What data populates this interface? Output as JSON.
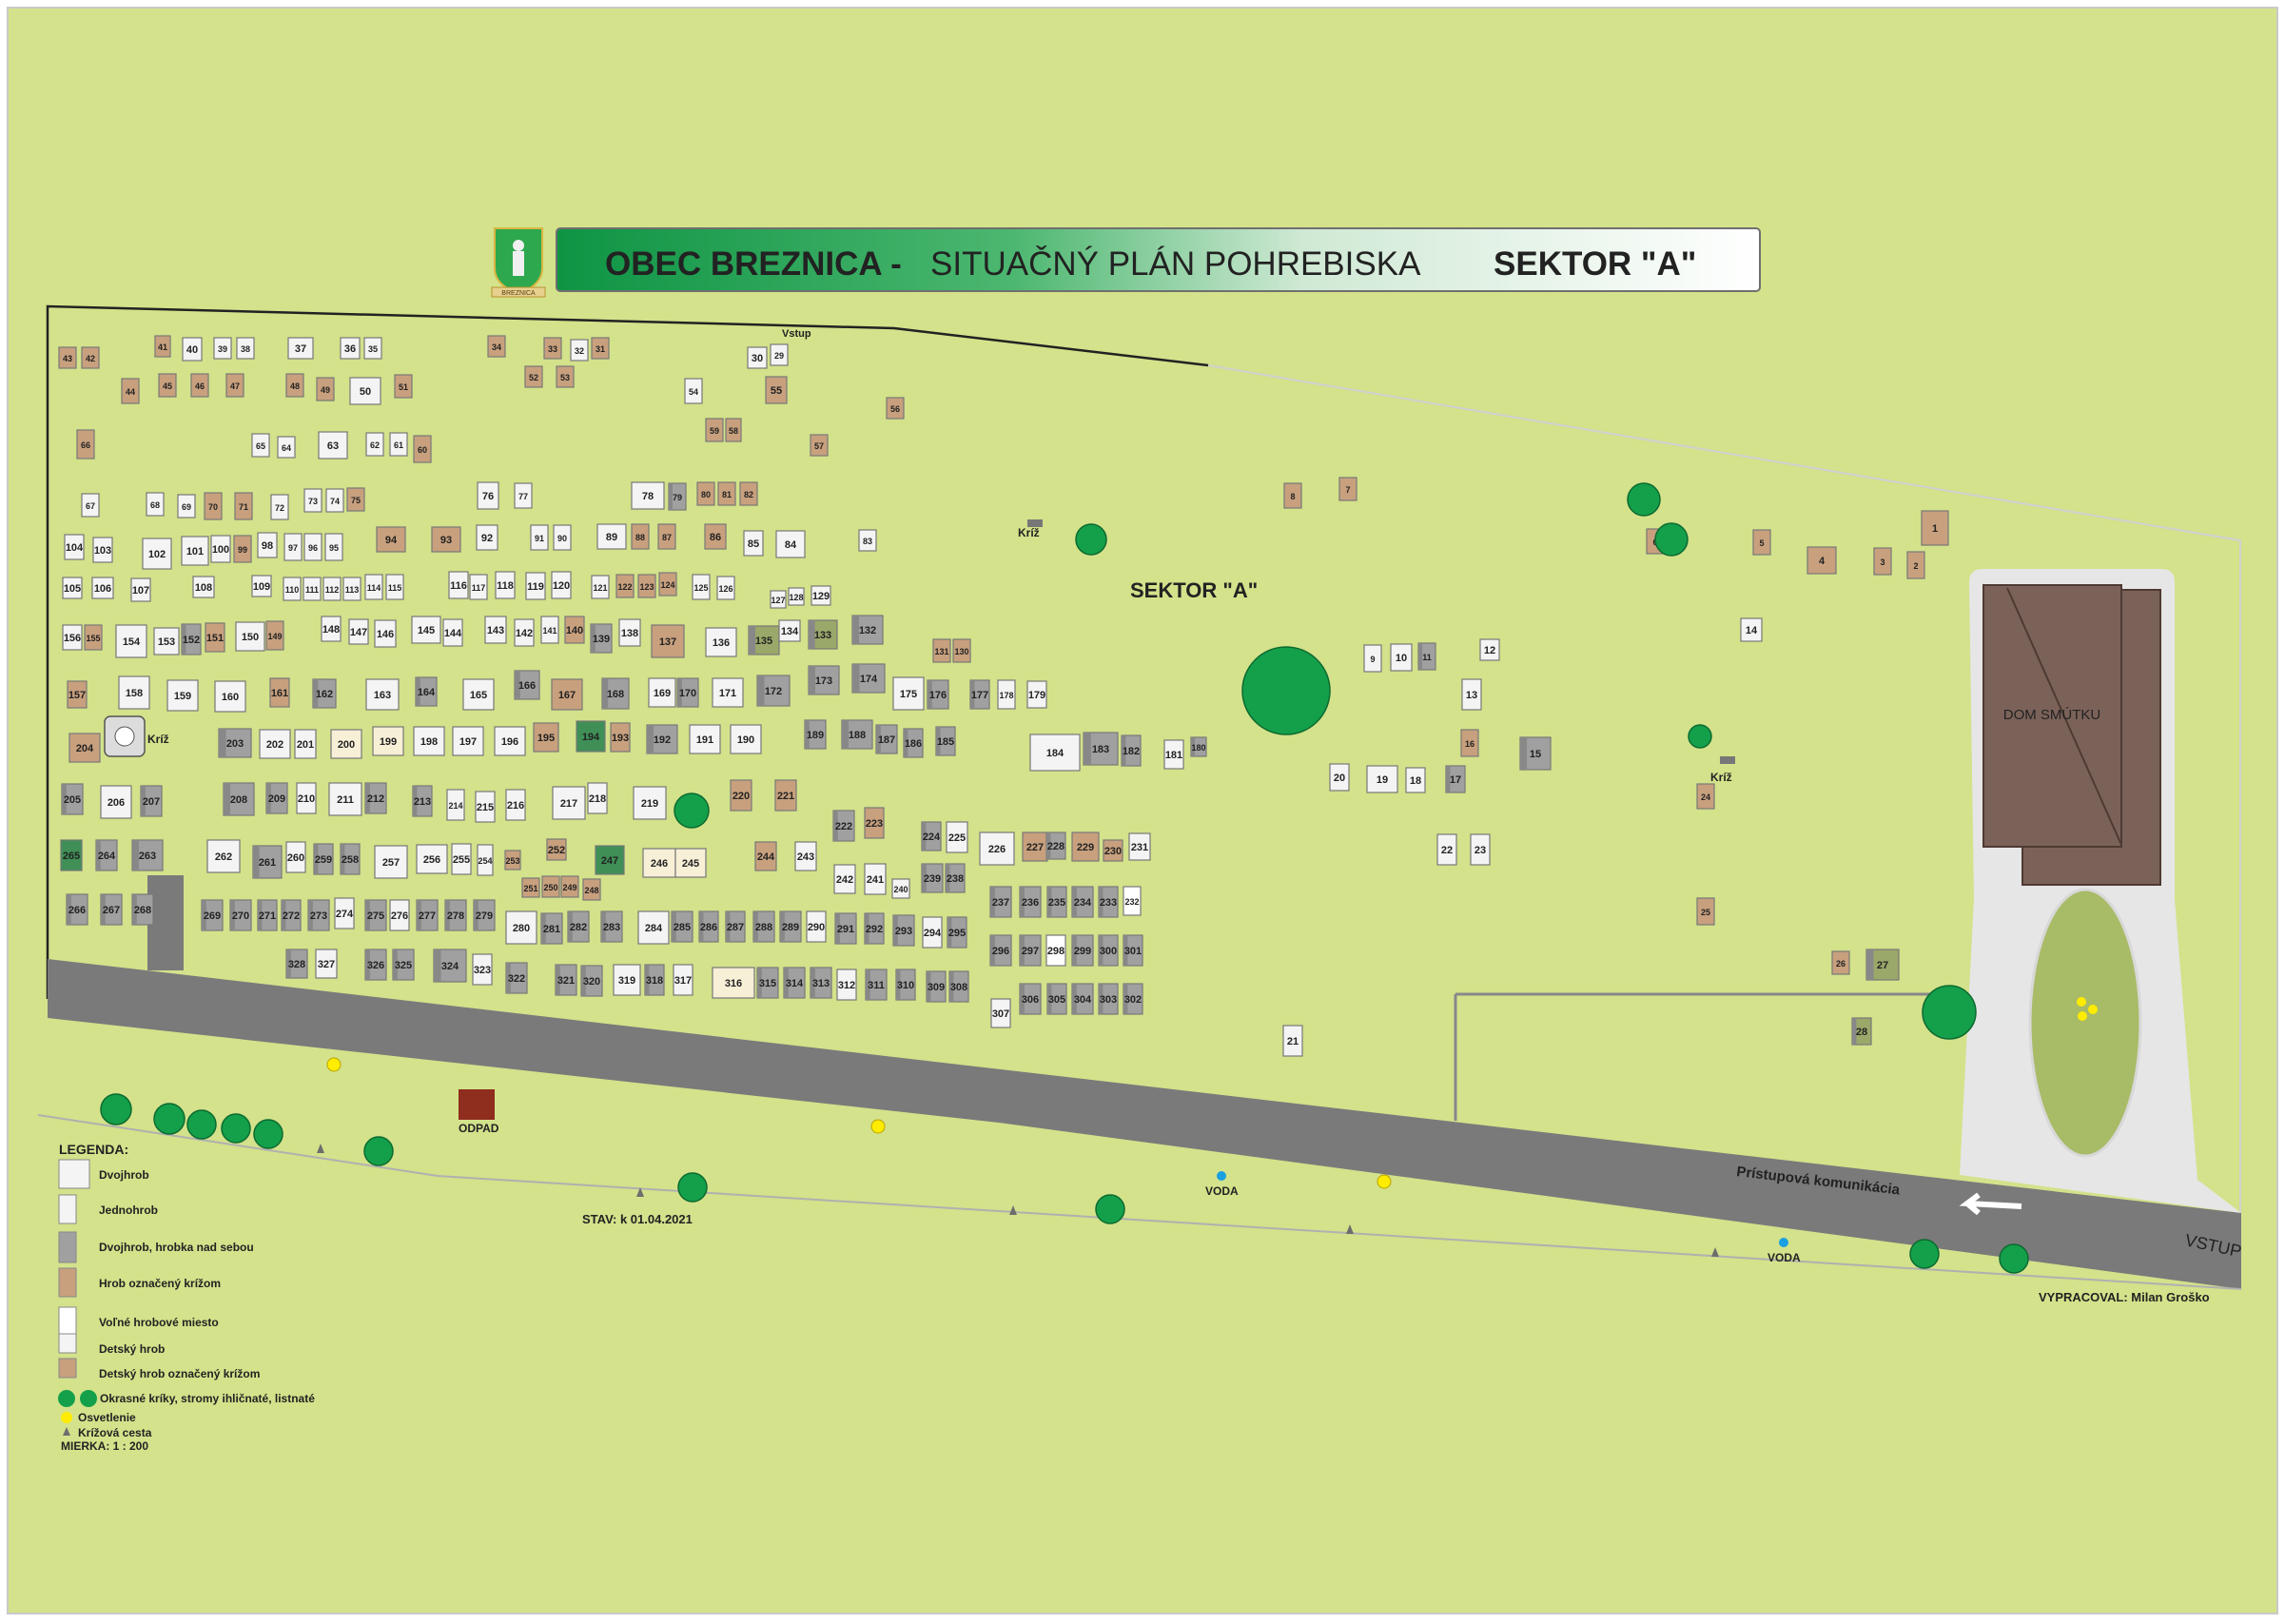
{
  "header": {
    "title_a": "OBEC  BREZNICA - ",
    "title_b": "SITUAČNÝ PLÁN POHREBISKA",
    "title_c": "SEKTOR  \"A\"",
    "crest_text": "BREZNICA"
  },
  "labels": {
    "sector": "SEKTOR \"A\"",
    "entrance_top": "Vstup",
    "cross": "Kríž",
    "chapel": "DOM  SMÚTKU",
    "waste": "ODPAD",
    "water": "VODA",
    "road": "Prístupová komunikácia",
    "entrance_road": "VSTUP",
    "status": "STAV: k 01.04.2021",
    "author": "VYPRACOVAL: Milan Groško"
  },
  "legend": {
    "title": "LEGENDA:",
    "items": [
      {
        "kind": "double",
        "label": "Dvojhrob"
      },
      {
        "kind": "single",
        "label": "Jednohrob"
      },
      {
        "kind": "tomb",
        "label": "Dvojhrob, hrobka  nad sebou"
      },
      {
        "kind": "cross",
        "label": "Hrob označený krížom"
      },
      {
        "kind": "free",
        "label": "Voľné hrobové miesto"
      },
      {
        "kind": "child",
        "label": "Detský hrob"
      },
      {
        "kind": "childcross",
        "label": "Detský hrob označený krížom"
      },
      {
        "kind": "tree",
        "label": "Okrasné kríky, stromy ihličnaté, listnaté"
      },
      {
        "kind": "light",
        "label": "Osvetlenie"
      },
      {
        "kind": "way",
        "label": "Krížová cesta"
      }
    ],
    "scale": "MIERKA: 1 : 200"
  },
  "colors": {
    "grass": "#d3e28b",
    "road": "#7a7a7a",
    "path": "#e6e6e6",
    "brown": "#c8a07e",
    "gray": "#a0a0a0",
    "white": "#f4f4f4",
    "green": "#3f8f57",
    "cream": "#f7efd6",
    "tree": "#14a04a",
    "roof": "#7b6259",
    "banner": "#16a04f",
    "light": "#ffec00",
    "water": "#1aa0e0"
  },
  "graves": [
    {
      "n": "43",
      "t": "b"
    },
    {
      "n": "42",
      "t": "b"
    },
    {
      "n": "41",
      "t": "b"
    },
    {
      "n": "40",
      "t": "w"
    },
    {
      "n": "39",
      "t": "w"
    },
    {
      "n": "38",
      "t": "w"
    },
    {
      "n": "37",
      "t": "w"
    },
    {
      "n": "36",
      "t": "w"
    },
    {
      "n": "35",
      "t": "w"
    },
    {
      "n": "34",
      "t": "b"
    },
    {
      "n": "33",
      "t": "b"
    },
    {
      "n": "32",
      "t": "w"
    },
    {
      "n": "31",
      "t": "b"
    },
    {
      "n": "30",
      "t": "w"
    },
    {
      "n": "29",
      "t": "w"
    },
    {
      "n": "44",
      "t": "b"
    },
    {
      "n": "45",
      "t": "b"
    },
    {
      "n": "46",
      "t": "b"
    },
    {
      "n": "47",
      "t": "b"
    },
    {
      "n": "48",
      "t": "b"
    },
    {
      "n": "49",
      "t": "b"
    },
    {
      "n": "50",
      "t": "w"
    },
    {
      "n": "51",
      "t": "b"
    },
    {
      "n": "52",
      "t": "b"
    },
    {
      "n": "53",
      "t": "b"
    },
    {
      "n": "54",
      "t": "w"
    },
    {
      "n": "55",
      "t": "b"
    },
    {
      "n": "56",
      "t": "b"
    },
    {
      "n": "66",
      "t": "b"
    },
    {
      "n": "65",
      "t": "w"
    },
    {
      "n": "64",
      "t": "w"
    },
    {
      "n": "63",
      "t": "w"
    },
    {
      "n": "62",
      "t": "w"
    },
    {
      "n": "61",
      "t": "w"
    },
    {
      "n": "60",
      "t": "b"
    },
    {
      "n": "59",
      "t": "b"
    },
    {
      "n": "58",
      "t": "b"
    },
    {
      "n": "57",
      "t": "b"
    },
    {
      "n": "67",
      "t": "w"
    },
    {
      "n": "68",
      "t": "w"
    },
    {
      "n": "69",
      "t": "w"
    },
    {
      "n": "70",
      "t": "b"
    },
    {
      "n": "71",
      "t": "b"
    },
    {
      "n": "72",
      "t": "w"
    },
    {
      "n": "73",
      "t": "w"
    },
    {
      "n": "74",
      "t": "w"
    },
    {
      "n": "75",
      "t": "b"
    },
    {
      "n": "76",
      "t": "w"
    },
    {
      "n": "77",
      "t": "w"
    },
    {
      "n": "78",
      "t": "w"
    },
    {
      "n": "79",
      "t": "g"
    },
    {
      "n": "80",
      "t": "b"
    },
    {
      "n": "81",
      "t": "b"
    },
    {
      "n": "82",
      "t": "b"
    },
    {
      "n": "8",
      "t": "b"
    },
    {
      "n": "7",
      "t": "b"
    },
    {
      "n": "104",
      "t": "w"
    },
    {
      "n": "103",
      "t": "w"
    },
    {
      "n": "102",
      "t": "w"
    },
    {
      "n": "101",
      "t": "w"
    },
    {
      "n": "100",
      "t": "w"
    },
    {
      "n": "99",
      "t": "b"
    },
    {
      "n": "98",
      "t": "w"
    },
    {
      "n": "97",
      "t": "w"
    },
    {
      "n": "96",
      "t": "w"
    },
    {
      "n": "95",
      "t": "w"
    },
    {
      "n": "94",
      "t": "b"
    },
    {
      "n": "93",
      "t": "b"
    },
    {
      "n": "92",
      "t": "w"
    },
    {
      "n": "91",
      "t": "w"
    },
    {
      "n": "90",
      "t": "w"
    },
    {
      "n": "89",
      "t": "w"
    },
    {
      "n": "88",
      "t": "b"
    },
    {
      "n": "87",
      "t": "b"
    },
    {
      "n": "86",
      "t": "b"
    },
    {
      "n": "85",
      "t": "w"
    },
    {
      "n": "84",
      "t": "w"
    },
    {
      "n": "83",
      "t": "w"
    },
    {
      "n": "105",
      "t": "w"
    },
    {
      "n": "106",
      "t": "w"
    },
    {
      "n": "107",
      "t": "w"
    },
    {
      "n": "108",
      "t": "w"
    },
    {
      "n": "109",
      "t": "w"
    },
    {
      "n": "110",
      "t": "w"
    },
    {
      "n": "111",
      "t": "w"
    },
    {
      "n": "112",
      "t": "w"
    },
    {
      "n": "113",
      "t": "w"
    },
    {
      "n": "114",
      "t": "w"
    },
    {
      "n": "115",
      "t": "w"
    },
    {
      "n": "116",
      "t": "w"
    },
    {
      "n": "117",
      "t": "w"
    },
    {
      "n": "118",
      "t": "w"
    },
    {
      "n": "119",
      "t": "w"
    },
    {
      "n": "120",
      "t": "w"
    },
    {
      "n": "121",
      "t": "w"
    },
    {
      "n": "122",
      "t": "b"
    },
    {
      "n": "123",
      "t": "b"
    },
    {
      "n": "124",
      "t": "b"
    },
    {
      "n": "125",
      "t": "w"
    },
    {
      "n": "126",
      "t": "w"
    },
    {
      "n": "127",
      "t": "w"
    },
    {
      "n": "128",
      "t": "w"
    },
    {
      "n": "129",
      "t": "w"
    },
    {
      "n": "156",
      "t": "w"
    },
    {
      "n": "155",
      "t": "b"
    },
    {
      "n": "154",
      "t": "w"
    },
    {
      "n": "153",
      "t": "w"
    },
    {
      "n": "152",
      "t": "g"
    },
    {
      "n": "151",
      "t": "b"
    },
    {
      "n": "150",
      "t": "w"
    },
    {
      "n": "149",
      "t": "b"
    },
    {
      "n": "148",
      "t": "w"
    },
    {
      "n": "147",
      "t": "w"
    },
    {
      "n": "146",
      "t": "w"
    },
    {
      "n": "145",
      "t": "w"
    },
    {
      "n": "144",
      "t": "w"
    },
    {
      "n": "143",
      "t": "w"
    },
    {
      "n": "142",
      "t": "w"
    },
    {
      "n": "141",
      "t": "w"
    },
    {
      "n": "140",
      "t": "b"
    },
    {
      "n": "139",
      "t": "g"
    },
    {
      "n": "138",
      "t": "w"
    },
    {
      "n": "137",
      "t": "b"
    },
    {
      "n": "136",
      "t": "w"
    },
    {
      "n": "135",
      "t": "m"
    },
    {
      "n": "134",
      "t": "w"
    },
    {
      "n": "133",
      "t": "m"
    },
    {
      "n": "132",
      "t": "g"
    },
    {
      "n": "131",
      "t": "b"
    },
    {
      "n": "130",
      "t": "b"
    },
    {
      "n": "157",
      "t": "b"
    },
    {
      "n": "158",
      "t": "w"
    },
    {
      "n": "159",
      "t": "w"
    },
    {
      "n": "160",
      "t": "w"
    },
    {
      "n": "161",
      "t": "b"
    },
    {
      "n": "162",
      "t": "g"
    },
    {
      "n": "163",
      "t": "w"
    },
    {
      "n": "164",
      "t": "g"
    },
    {
      "n": "165",
      "t": "w"
    },
    {
      "n": "166",
      "t": "g"
    },
    {
      "n": "167",
      "t": "b"
    },
    {
      "n": "168",
      "t": "g"
    },
    {
      "n": "169",
      "t": "w"
    },
    {
      "n": "170",
      "t": "g"
    },
    {
      "n": "171",
      "t": "w"
    },
    {
      "n": "172",
      "t": "g"
    },
    {
      "n": "173",
      "t": "g"
    },
    {
      "n": "174",
      "t": "g"
    },
    {
      "n": "175",
      "t": "w"
    },
    {
      "n": "176",
      "t": "g"
    },
    {
      "n": "177",
      "t": "g"
    },
    {
      "n": "178",
      "t": "w"
    },
    {
      "n": "179",
      "t": "w"
    },
    {
      "n": "204",
      "t": "b"
    },
    {
      "n": "203",
      "t": "g"
    },
    {
      "n": "202",
      "t": "w"
    },
    {
      "n": "201",
      "t": "w"
    },
    {
      "n": "200",
      "t": "c"
    },
    {
      "n": "199",
      "t": "c"
    },
    {
      "n": "198",
      "t": "w"
    },
    {
      "n": "197",
      "t": "w"
    },
    {
      "n": "196",
      "t": "w"
    },
    {
      "n": "195",
      "t": "b"
    },
    {
      "n": "194",
      "t": "gr"
    },
    {
      "n": "193",
      "t": "b"
    },
    {
      "n": "192",
      "t": "g"
    },
    {
      "n": "191",
      "t": "w"
    },
    {
      "n": "190",
      "t": "w"
    },
    {
      "n": "189",
      "t": "g"
    },
    {
      "n": "188",
      "t": "g"
    },
    {
      "n": "187",
      "t": "g"
    },
    {
      "n": "186",
      "t": "g"
    },
    {
      "n": "185",
      "t": "g"
    },
    {
      "n": "184",
      "t": "w"
    },
    {
      "n": "183",
      "t": "g"
    },
    {
      "n": "182",
      "t": "g"
    },
    {
      "n": "181",
      "t": "w"
    },
    {
      "n": "180",
      "t": "g"
    },
    {
      "n": "205",
      "t": "g"
    },
    {
      "n": "206",
      "t": "w"
    },
    {
      "n": "207",
      "t": "g"
    },
    {
      "n": "208",
      "t": "g"
    },
    {
      "n": "209",
      "t": "g"
    },
    {
      "n": "210",
      "t": "w"
    },
    {
      "n": "211",
      "t": "w"
    },
    {
      "n": "212",
      "t": "g"
    },
    {
      "n": "213",
      "t": "g"
    },
    {
      "n": "214",
      "t": "w"
    },
    {
      "n": "215",
      "t": "w"
    },
    {
      "n": "216",
      "t": "w"
    },
    {
      "n": "217",
      "t": "w"
    },
    {
      "n": "218",
      "t": "w"
    },
    {
      "n": "219",
      "t": "w"
    },
    {
      "n": "220",
      "t": "b"
    },
    {
      "n": "221",
      "t": "b"
    },
    {
      "n": "222",
      "t": "g"
    },
    {
      "n": "223",
      "t": "b"
    },
    {
      "n": "224",
      "t": "g"
    },
    {
      "n": "225",
      "t": "w"
    },
    {
      "n": "226",
      "t": "w"
    },
    {
      "n": "227",
      "t": "b"
    },
    {
      "n": "228",
      "t": "g"
    },
    {
      "n": "229",
      "t": "b"
    },
    {
      "n": "230",
      "t": "b"
    },
    {
      "n": "231",
      "t": "w"
    },
    {
      "n": "265",
      "t": "gr"
    },
    {
      "n": "264",
      "t": "g"
    },
    {
      "n": "263",
      "t": "g"
    },
    {
      "n": "262",
      "t": "w"
    },
    {
      "n": "261",
      "t": "g"
    },
    {
      "n": "260",
      "t": "w"
    },
    {
      "n": "259",
      "t": "g"
    },
    {
      "n": "258",
      "t": "g"
    },
    {
      "n": "257",
      "t": "w"
    },
    {
      "n": "256",
      "t": "w"
    },
    {
      "n": "255",
      "t": "w"
    },
    {
      "n": "254",
      "t": "w"
    },
    {
      "n": "253",
      "t": "b"
    },
    {
      "n": "252",
      "t": "b"
    },
    {
      "n": "251",
      "t": "b"
    },
    {
      "n": "250",
      "t": "b"
    },
    {
      "n": "249",
      "t": "b"
    },
    {
      "n": "248",
      "t": "b"
    },
    {
      "n": "247",
      "t": "gr"
    },
    {
      "n": "246",
      "t": "c"
    },
    {
      "n": "245",
      "t": "c"
    },
    {
      "n": "244",
      "t": "b"
    },
    {
      "n": "243",
      "t": "w"
    },
    {
      "n": "242",
      "t": "w"
    },
    {
      "n": "241",
      "t": "w"
    },
    {
      "n": "240",
      "t": "w"
    },
    {
      "n": "239",
      "t": "g"
    },
    {
      "n": "238",
      "t": "g"
    },
    {
      "n": "266",
      "t": "g"
    },
    {
      "n": "267",
      "t": "g"
    },
    {
      "n": "268",
      "t": "g"
    },
    {
      "n": "269",
      "t": "g"
    },
    {
      "n": "270",
      "t": "g"
    },
    {
      "n": "271",
      "t": "g"
    },
    {
      "n": "272",
      "t": "g"
    },
    {
      "n": "273",
      "t": "g"
    },
    {
      "n": "274",
      "t": "w"
    },
    {
      "n": "275",
      "t": "g"
    },
    {
      "n": "276",
      "t": "w"
    },
    {
      "n": "277",
      "t": "g"
    },
    {
      "n": "278",
      "t": "g"
    },
    {
      "n": "279",
      "t": "g"
    },
    {
      "n": "280",
      "t": "w"
    },
    {
      "n": "281",
      "t": "g"
    },
    {
      "n": "282",
      "t": "g"
    },
    {
      "n": "283",
      "t": "g"
    },
    {
      "n": "284",
      "t": "w"
    },
    {
      "n": "285",
      "t": "g"
    },
    {
      "n": "286",
      "t": "g"
    },
    {
      "n": "287",
      "t": "g"
    },
    {
      "n": "288",
      "t": "g"
    },
    {
      "n": "289",
      "t": "g"
    },
    {
      "n": "290",
      "t": "w"
    },
    {
      "n": "291",
      "t": "g"
    },
    {
      "n": "292",
      "t": "g"
    },
    {
      "n": "293",
      "t": "g"
    },
    {
      "n": "294",
      "t": "w"
    },
    {
      "n": "295",
      "t": "g"
    },
    {
      "n": "237",
      "t": "g"
    },
    {
      "n": "236",
      "t": "g"
    },
    {
      "n": "235",
      "t": "g"
    },
    {
      "n": "234",
      "t": "g"
    },
    {
      "n": "233",
      "t": "g"
    },
    {
      "n": "232",
      "t": "f"
    },
    {
      "n": "328",
      "t": "g"
    },
    {
      "n": "327",
      "t": "w"
    },
    {
      "n": "326",
      "t": "g"
    },
    {
      "n": "325",
      "t": "g"
    },
    {
      "n": "324",
      "t": "g"
    },
    {
      "n": "323",
      "t": "w"
    },
    {
      "n": "322",
      "t": "g"
    },
    {
      "n": "321",
      "t": "g"
    },
    {
      "n": "320",
      "t": "g"
    },
    {
      "n": "319",
      "t": "w"
    },
    {
      "n": "318",
      "t": "g"
    },
    {
      "n": "317",
      "t": "w"
    },
    {
      "n": "316",
      "t": "c"
    },
    {
      "n": "315",
      "t": "g"
    },
    {
      "n": "314",
      "t": "g"
    },
    {
      "n": "313",
      "t": "g"
    },
    {
      "n": "312",
      "t": "w"
    },
    {
      "n": "311",
      "t": "g"
    },
    {
      "n": "310",
      "t": "g"
    },
    {
      "n": "309",
      "t": "g"
    },
    {
      "n": "308",
      "t": "g"
    },
    {
      "n": "307",
      "t": "w"
    },
    {
      "n": "296",
      "t": "g"
    },
    {
      "n": "297",
      "t": "g"
    },
    {
      "n": "298",
      "t": "f"
    },
    {
      "n": "299",
      "t": "g"
    },
    {
      "n": "300",
      "t": "g"
    },
    {
      "n": "301",
      "t": "g"
    },
    {
      "n": "306",
      "t": "g"
    },
    {
      "n": "305",
      "t": "g"
    },
    {
      "n": "304",
      "t": "g"
    },
    {
      "n": "303",
      "t": "g"
    },
    {
      "n": "302",
      "t": "g"
    },
    {
      "n": "1",
      "t": "b"
    },
    {
      "n": "2",
      "t": "b"
    },
    {
      "n": "3",
      "t": "b"
    },
    {
      "n": "4",
      "t": "b"
    },
    {
      "n": "5",
      "t": "b"
    },
    {
      "n": "6",
      "t": "b"
    },
    {
      "n": "9",
      "t": "w"
    },
    {
      "n": "10",
      "t": "w"
    },
    {
      "n": "11",
      "t": "g"
    },
    {
      "n": "12",
      "t": "w"
    },
    {
      "n": "13",
      "t": "w"
    },
    {
      "n": "14",
      "t": "w"
    },
    {
      "n": "15",
      "t": "g"
    },
    {
      "n": "16",
      "t": "b"
    },
    {
      "n": "17",
      "t": "g"
    },
    {
      "n": "18",
      "t": "w"
    },
    {
      "n": "19",
      "t": "w"
    },
    {
      "n": "20",
      "t": "w"
    },
    {
      "n": "21",
      "t": "w"
    },
    {
      "n": "22",
      "t": "w"
    },
    {
      "n": "23",
      "t": "w"
    },
    {
      "n": "24",
      "t": "b"
    },
    {
      "n": "25",
      "t": "b"
    },
    {
      "n": "26",
      "t": "b"
    },
    {
      "n": "27",
      "t": "m"
    },
    {
      "n": "28",
      "t": "m"
    }
  ]
}
